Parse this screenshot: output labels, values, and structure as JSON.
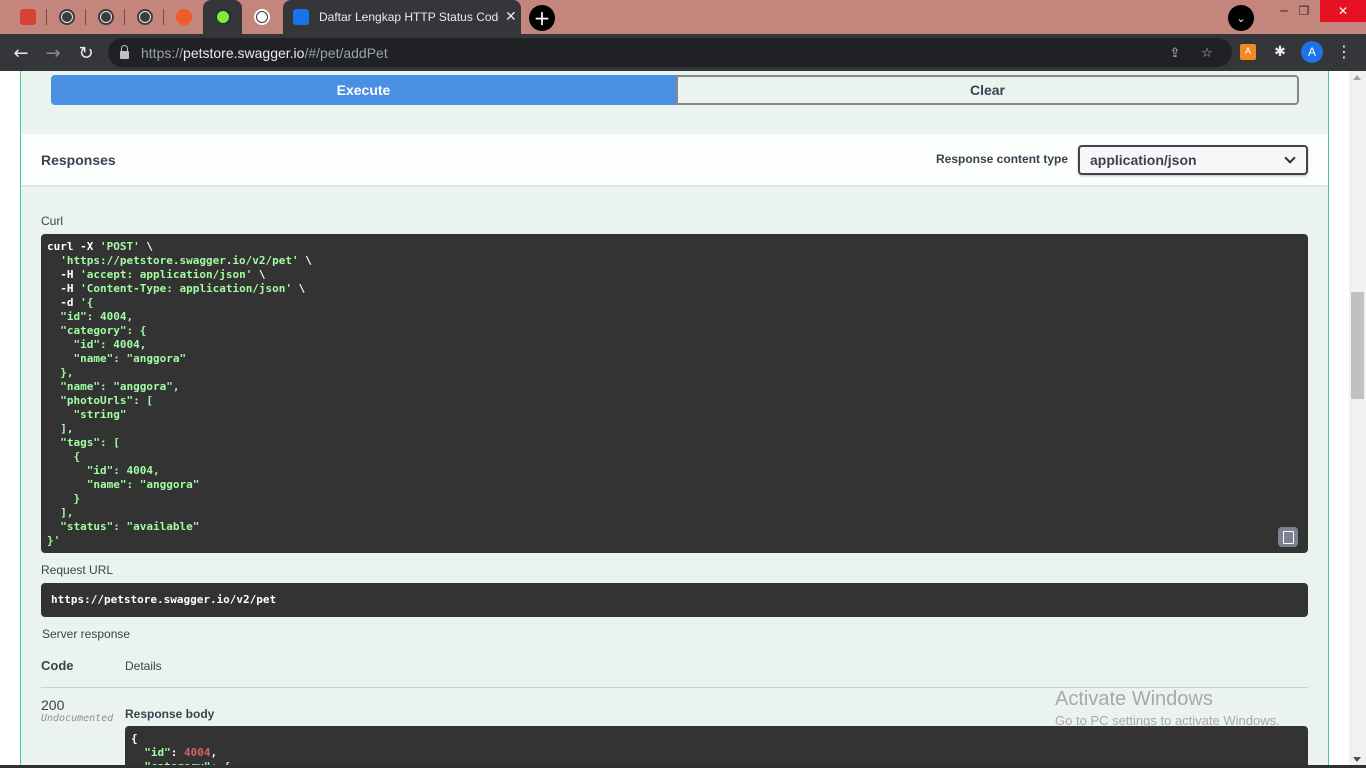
{
  "browser": {
    "active_tab_title": "Daftar Lengkap HTTP Status Code",
    "close_glyph": "✕",
    "newtab_glyph": "+",
    "url_scheme": "https://",
    "url_host": "petstore.swagger.io",
    "url_path": "/#/pet/addPet",
    "profile_initial": "A",
    "ext_badge": "A",
    "window_controls": {
      "minimize": "─",
      "maximize": "❐",
      "close": "✕"
    },
    "nav": {
      "back": "←",
      "forward": "→",
      "reload": "↻",
      "menu": "⋮"
    },
    "icons": [
      "todoist-icon",
      "globe-icon",
      "globe-icon",
      "globe-icon",
      "postman-icon",
      "swagger-icon",
      "globe-icon"
    ]
  },
  "swagger": {
    "execute_label": "Execute",
    "clear_label": "Clear",
    "responses_title": "Responses",
    "content_type_label": "Response content type",
    "content_type_value": "application/json",
    "curl_label": "Curl",
    "curl_command": [
      {
        "t": "curl -X ",
        "s": "'POST'",
        "e": " \\"
      },
      {
        "t": "  ",
        "s": "'https://petstore.swagger.io/v2/pet'",
        "e": " \\"
      },
      {
        "t": "  -H ",
        "s": "'accept: application/json'",
        "e": " \\"
      },
      {
        "t": "  -H ",
        "s": "'Content-Type: application/json'",
        "e": " \\"
      },
      {
        "t": "  -d ",
        "s": "'{",
        "e": ""
      },
      {
        "t": "",
        "s": "  \"id\": 4004,",
        "e": ""
      },
      {
        "t": "",
        "s": "  \"category\": {",
        "e": ""
      },
      {
        "t": "",
        "s": "    \"id\": 4004,",
        "e": ""
      },
      {
        "t": "",
        "s": "    \"name\": \"anggora\"",
        "e": ""
      },
      {
        "t": "",
        "s": "  },",
        "e": ""
      },
      {
        "t": "",
        "s": "  \"name\": \"anggora\",",
        "e": ""
      },
      {
        "t": "",
        "s": "  \"photoUrls\": [",
        "e": ""
      },
      {
        "t": "",
        "s": "    \"string\"",
        "e": ""
      },
      {
        "t": "",
        "s": "  ],",
        "e": ""
      },
      {
        "t": "",
        "s": "  \"tags\": [",
        "e": ""
      },
      {
        "t": "",
        "s": "    {",
        "e": ""
      },
      {
        "t": "",
        "s": "      \"id\": 4004,",
        "e": ""
      },
      {
        "t": "",
        "s": "      \"name\": \"anggora\"",
        "e": ""
      },
      {
        "t": "",
        "s": "    }",
        "e": ""
      },
      {
        "t": "",
        "s": "  ],",
        "e": ""
      },
      {
        "t": "",
        "s": "  \"status\": \"available\"",
        "e": ""
      },
      {
        "t": "",
        "s": "}'",
        "e": ""
      }
    ],
    "request_url_label": "Request URL",
    "request_url": "https://petstore.swagger.io/v2/pet",
    "server_response_label": "Server response",
    "col_code": "Code",
    "col_details": "Details",
    "response_code": "200",
    "response_code_note": "Undocumented",
    "response_body_label": "Response body",
    "response_body_line1": "{",
    "response_body_key": "\"id\"",
    "response_body_val": "4004",
    "response_body_partial": "\"category\": {"
  },
  "os": {
    "watermark_title": "Activate Windows",
    "watermark_sub": "Go to PC settings to activate Windows."
  },
  "colors": {
    "execute_blue": "#4990e2",
    "post_green": "#49cc90",
    "code_bg": "#333333",
    "code_string": "#a2fca2"
  }
}
